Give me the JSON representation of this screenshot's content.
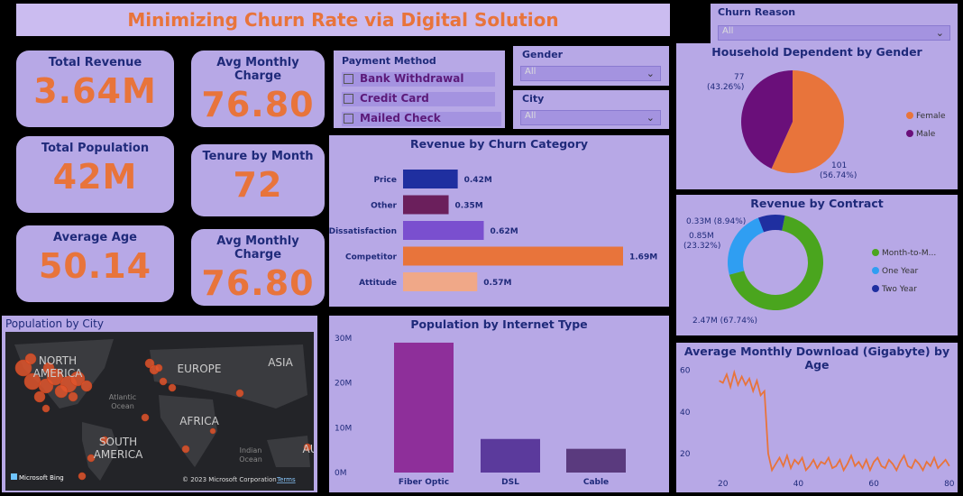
{
  "title": "Minimizing Churn Rate via Digital Solution",
  "kpis": {
    "total_revenue": {
      "label": "Total Revenue",
      "value": "3.64M"
    },
    "avg_monthly_charge_1": {
      "label": "Avg Monthly Charge",
      "value": "76.80"
    },
    "total_population": {
      "label": "Total Population",
      "value": "42M"
    },
    "tenure": {
      "label": "Tenure by Month",
      "value": "72"
    },
    "average_age": {
      "label": "Average Age",
      "value": "50.14"
    },
    "avg_monthly_charge_2": {
      "label": "Avg Monthly Charge",
      "value": "76.80"
    }
  },
  "payment_method": {
    "label": "Payment Method",
    "options": [
      "Bank Withdrawal",
      "Credit Card",
      "Mailed Check"
    ]
  },
  "gender_filter": {
    "label": "Gender",
    "value": "All"
  },
  "city_filter": {
    "label": "City",
    "value": "All"
  },
  "churn_reason_filter": {
    "label": "Churn Reason",
    "value": "All"
  },
  "colors": {
    "accent": "#e8743b",
    "panel": "#b7a8e6",
    "title_text": "#1f2a7a"
  },
  "chart_data": [
    {
      "id": "revenue_by_churn",
      "type": "bar",
      "orientation": "horizontal",
      "title": "Revenue by Churn Category",
      "categories": [
        "Price",
        "Other",
        "Dissatisfaction",
        "Competitor",
        "Attitude"
      ],
      "values": [
        0.42,
        0.35,
        0.62,
        1.69,
        0.57
      ],
      "value_labels": [
        "0.42M",
        "0.35M",
        "0.62M",
        "1.69M",
        "0.57M"
      ],
      "colors": [
        "#1f2fa0",
        "#6b1f5c",
        "#7a4fcf",
        "#e8743b",
        "#f0a888"
      ]
    },
    {
      "id": "household_by_gender",
      "type": "pie",
      "title": "Household Dependent by Gender",
      "labels": [
        "Female",
        "Male"
      ],
      "values": [
        101,
        77
      ],
      "data_labels": [
        "101\n(56.74%)",
        "77\n(43.26%)"
      ],
      "colors": [
        "#e8743b",
        "#6a0f7a"
      ],
      "legend": "right"
    },
    {
      "id": "revenue_by_contract",
      "type": "pie",
      "subtype": "donut",
      "title": "Revenue by Contract",
      "labels": [
        "Month-to-M...",
        "One Year",
        "Two Year"
      ],
      "values": [
        2.47,
        0.85,
        0.33
      ],
      "data_labels": [
        "2.47M (67.74%)",
        "0.85M\n(23.32%)",
        "0.33M (8.94%)"
      ],
      "colors": [
        "#4aa51e",
        "#2f9ef2",
        "#1f2fa0"
      ],
      "legend": "right"
    },
    {
      "id": "population_by_internet",
      "type": "bar",
      "title": "Population by Internet Type",
      "categories": [
        "Fiber Optic",
        "DSL",
        "Cable"
      ],
      "values": [
        29,
        7.5,
        5.3
      ],
      "yticks": [
        "0M",
        "10M",
        "20M",
        "30M"
      ],
      "ylim": [
        0,
        30
      ],
      "colors": [
        "#8e2f9a",
        "#5b3a9c",
        "#5a3a7e"
      ]
    },
    {
      "id": "download_by_age",
      "type": "line",
      "title": "Average Monthly Download (Gigabyte) by Age",
      "x": [
        19,
        20,
        21,
        22,
        23,
        24,
        25,
        26,
        27,
        28,
        29,
        30,
        31,
        32,
        33,
        34,
        35,
        36,
        37,
        38,
        39,
        40,
        41,
        42,
        43,
        44,
        45,
        46,
        47,
        48,
        49,
        50,
        51,
        52,
        53,
        54,
        55,
        56,
        57,
        58,
        59,
        60,
        61,
        62,
        63,
        64,
        65,
        66,
        67,
        68,
        69,
        70,
        71,
        72,
        73,
        74,
        75,
        76,
        77,
        78,
        79,
        80
      ],
      "y": [
        55,
        54,
        58,
        52,
        59,
        53,
        57,
        53,
        56,
        50,
        55,
        48,
        50,
        20,
        12,
        15,
        18,
        14,
        19,
        13,
        17,
        15,
        18,
        12,
        14,
        17,
        13,
        16,
        15,
        18,
        13,
        14,
        17,
        12,
        15,
        19,
        14,
        16,
        13,
        17,
        12,
        16,
        18,
        14,
        13,
        17,
        15,
        12,
        16,
        19,
        14,
        13,
        17,
        15,
        12,
        16,
        14,
        18,
        13,
        15,
        17,
        14
      ],
      "xticks": [
        "20",
        "40",
        "60",
        "80"
      ],
      "yticks": [
        "20",
        "40",
        "60"
      ],
      "ylim": [
        10,
        62
      ],
      "xlim": [
        16,
        81
      ],
      "color": "#e8743b"
    }
  ],
  "map": {
    "title": "Population by City",
    "labels": [
      "NORTH AMERICA",
      "EUROPE",
      "ASIA",
      "Atlantic Ocean",
      "AFRICA",
      "SOUTH AMERICA",
      "Indian Ocean",
      "AU"
    ],
    "footer_brand": "Microsoft Bing",
    "footer_copyright": "© 2023 Microsoft Corporation",
    "footer_terms": "Terms"
  }
}
